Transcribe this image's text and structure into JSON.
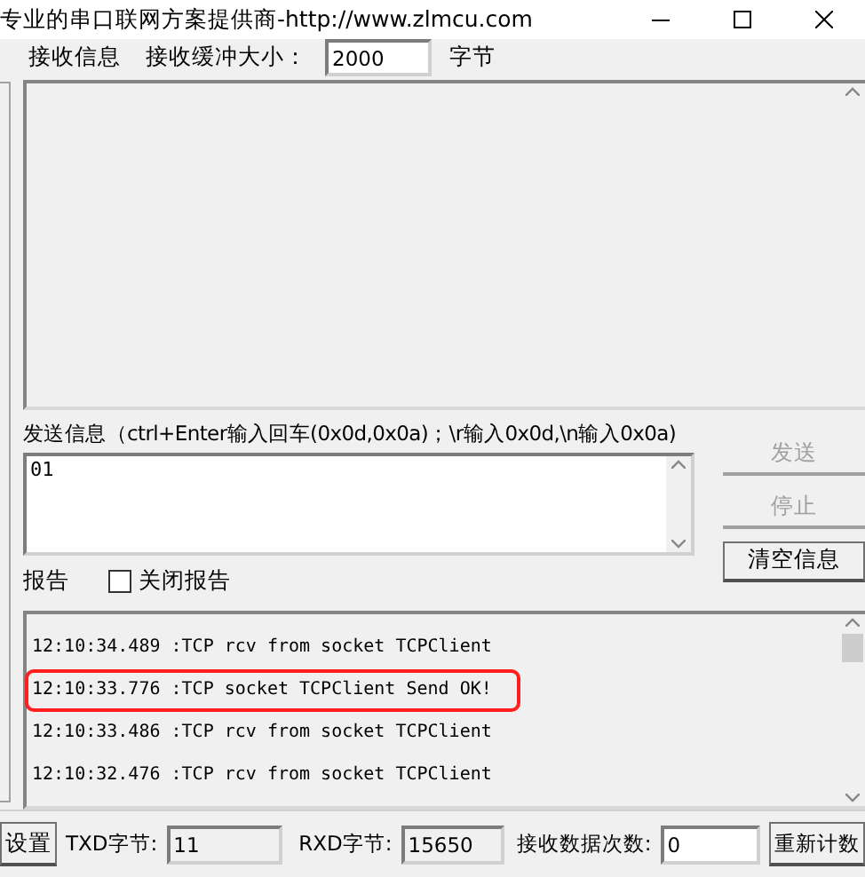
{
  "window": {
    "title": "专业的串口联网方案提供商-http://www.zlmcu.com"
  },
  "receive": {
    "label": "接收信息",
    "buffer_label": "接收缓冲大小：",
    "buffer_size": "2000",
    "unit": "字节"
  },
  "send": {
    "label": "发送信息（ctrl+Enter输入回车(0x0d,0x0a)；\\r输入0x0d,\\n输入0x0a)",
    "value": "01"
  },
  "buttons": [
    {
      "label": "发送",
      "disabled": true
    },
    {
      "label": "停止",
      "disabled": true
    },
    {
      "label": "清空信息",
      "disabled": false
    }
  ],
  "report": {
    "label": "报告",
    "checkbox": {
      "label": "关闭报告",
      "checked": false
    }
  },
  "log": [
    {
      "text": "12:10:34.489 :TCP rcv from socket TCPClient",
      "highlighted": false
    },
    {
      "text": "12:10:33.776 :TCP socket TCPClient Send OK!",
      "highlighted": true
    },
    {
      "text": "12:10:33.486 :TCP rcv from socket TCPClient",
      "highlighted": false
    },
    {
      "text": "12:10:32.476 :TCP rcv from socket TCPClient",
      "highlighted": false
    }
  ],
  "status_bar": {
    "settings_button": "设置",
    "txd_label": "TXD字节:",
    "txd": "11",
    "rxd_label": "RXD字节:",
    "rxd": "15650",
    "count_label": "接收数据次数:",
    "count": "0",
    "reset_button": "重新计数"
  }
}
